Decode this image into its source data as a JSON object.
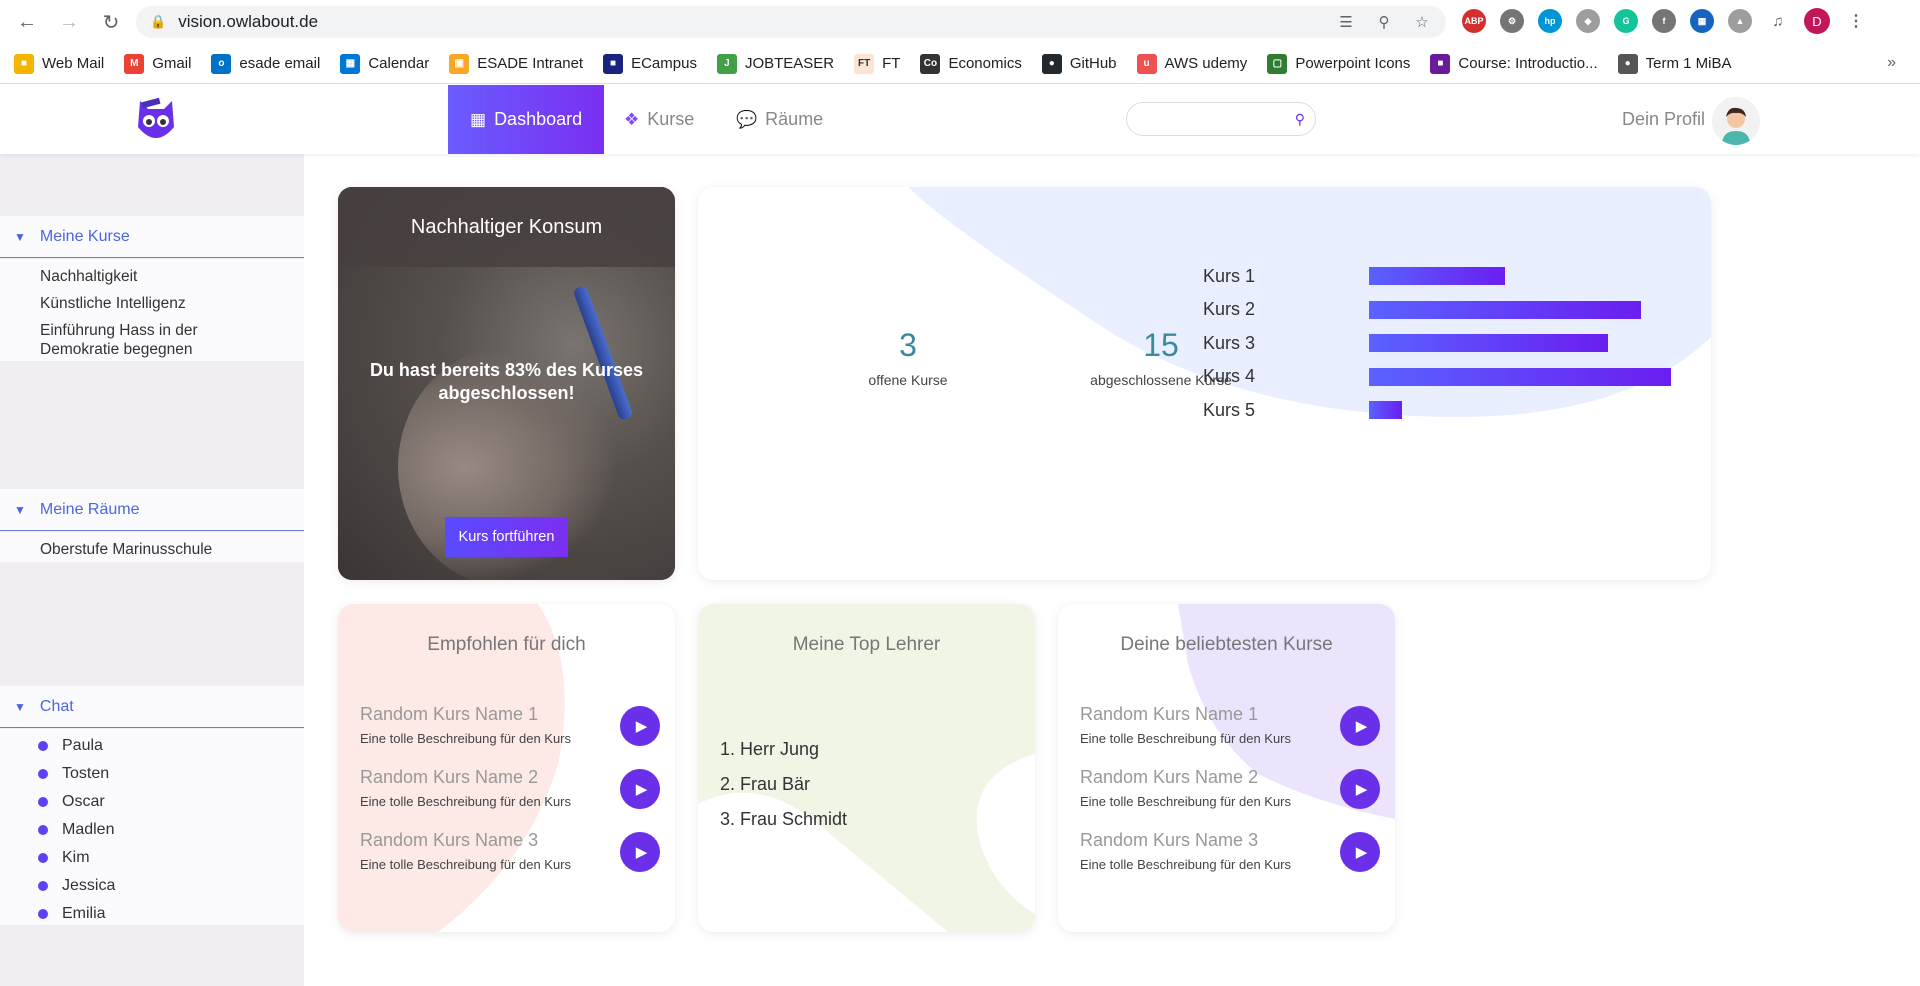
{
  "browser": {
    "url": "vision.owlabout.de",
    "profile_initial": "D",
    "bookmarks": [
      {
        "label": "Web Mail",
        "color": "#f4b400",
        "glyph": "■"
      },
      {
        "label": "Gmail",
        "color": "#ea4335",
        "glyph": "M"
      },
      {
        "label": "esade email",
        "color": "#0072c6",
        "glyph": "o"
      },
      {
        "label": "Calendar",
        "color": "#0078d4",
        "glyph": "▦"
      },
      {
        "label": "ESADE Intranet",
        "color": "#f9a825",
        "glyph": "▣"
      },
      {
        "label": "ECampus",
        "color": "#1a237e",
        "glyph": "■"
      },
      {
        "label": "JOBTEASER",
        "color": "#43a047",
        "glyph": "J"
      },
      {
        "label": "FT",
        "color": "#fce4d6",
        "glyph": "FT"
      },
      {
        "label": "Economics",
        "color": "#333333",
        "glyph": "Co"
      },
      {
        "label": "GitHub",
        "color": "#24292e",
        "glyph": "●"
      },
      {
        "label": "AWS udemy",
        "color": "#ec5252",
        "glyph": "u"
      },
      {
        "label": "Powerpoint Icons",
        "color": "#2e7d32",
        "glyph": "▢"
      },
      {
        "label": "Course: Introductio...",
        "color": "#6a1b9a",
        "glyph": "■"
      },
      {
        "label": "Term 1 MiBA",
        "color": "#555555",
        "glyph": "●"
      }
    ]
  },
  "header": {
    "tabs": [
      {
        "label": "Dashboard",
        "icon": "dashboard-icon"
      },
      {
        "label": "Kurse",
        "icon": "cubes-icon"
      },
      {
        "label": "Räume",
        "icon": "chat-bubbles-icon"
      }
    ],
    "search_placeholder": "",
    "profile_label": "Dein Profil"
  },
  "sidebar": {
    "courses_title": "Meine Kurse",
    "courses": [
      "Nachhaltigkeit",
      "Künstliche Intelligenz",
      "Einführung Hass in der Demokratie begegnen"
    ],
    "rooms_title": "Meine Räume",
    "rooms": [
      "Oberstufe Marinusschule"
    ],
    "chat_title": "Chat",
    "chat": [
      "Paula",
      "Tosten",
      "Oscar",
      "Madlen",
      "Kim",
      "Jessica",
      "Emilia"
    ]
  },
  "current_course": {
    "title": "Nachhaltiger Konsum",
    "progress_text": "Du hast bereits 83% des Kurses abgeschlossen!",
    "progress_percent": 83,
    "cta": "Kurs fortführen"
  },
  "stats": {
    "open_count": "3",
    "open_label": "offene Kurse",
    "done_count": "15",
    "done_label": "abgeschlossene Kurse"
  },
  "chart_data": {
    "type": "bar",
    "orientation": "horizontal",
    "categories": [
      "Kurs 1",
      "Kurs 2",
      "Kurs 3",
      "Kurs 4",
      "Kurs 5"
    ],
    "values": [
      0.45,
      0.9,
      0.79,
      1.0,
      0.11
    ],
    "title": "",
    "xlabel": "",
    "ylabel": "",
    "grid": false,
    "colors": [
      "#5a62ff",
      "#6a1ef0"
    ]
  },
  "recommended": {
    "title": "Empfohlen für dich",
    "items": [
      {
        "name": "Random Kurs Name 1",
        "desc": "Eine tolle Beschreibung für den Kurs"
      },
      {
        "name": "Random Kurs Name 2",
        "desc": "Eine tolle Beschreibung für den Kurs"
      },
      {
        "name": "Random Kurs Name 3",
        "desc": "Eine tolle Beschreibung für den Kurs"
      }
    ]
  },
  "teachers": {
    "title": "Meine Top Lehrer",
    "items": [
      "1. Herr Jung",
      "2. Frau Bär",
      "3. Frau Schmidt"
    ]
  },
  "popular": {
    "title": "Deine beliebtesten Kurse",
    "items": [
      {
        "name": "Random Kurs Name 1",
        "desc": "Eine tolle Beschreibung für den Kurs"
      },
      {
        "name": "Random Kurs Name 2",
        "desc": "Eine tolle Beschreibung für den Kurs"
      },
      {
        "name": "Random Kurs Name 3",
        "desc": "Eine tolle Beschreibung für den Kurs"
      }
    ]
  },
  "theme": {
    "accent": "#6a2fe8",
    "sidebar_accent": "#4a66e0"
  }
}
